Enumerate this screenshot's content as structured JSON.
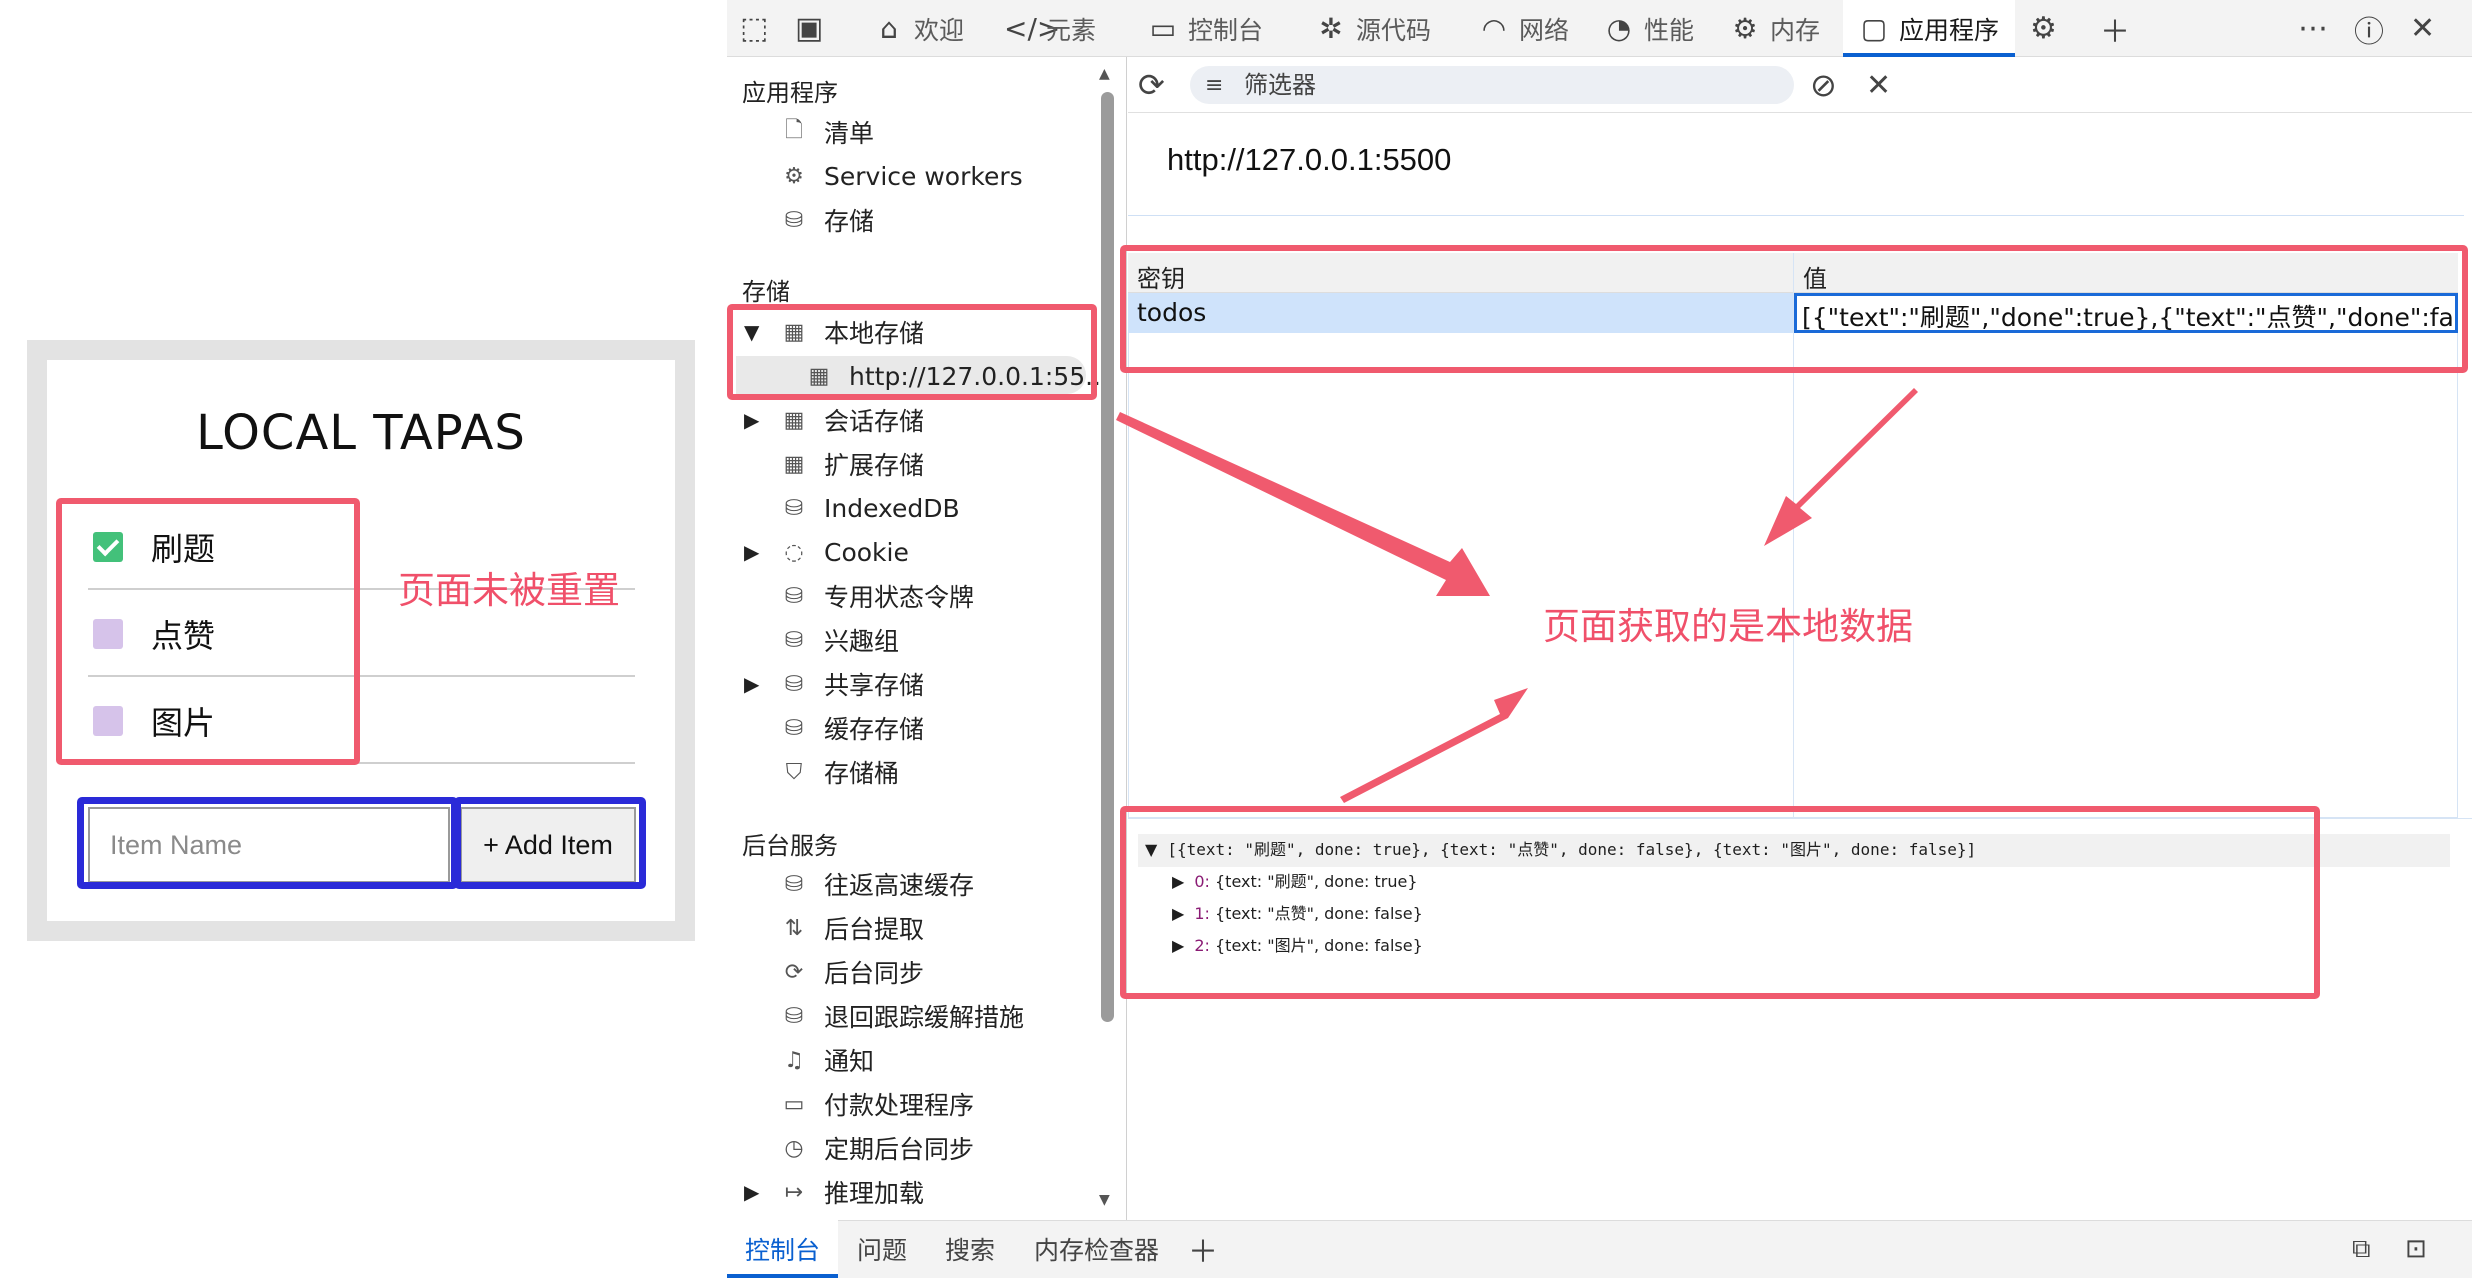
{
  "demo": {
    "title": "LOCAL TAPAS",
    "todos": [
      {
        "text": "刷题",
        "done": true
      },
      {
        "text": "点赞",
        "done": false
      },
      {
        "text": "图片",
        "done": false
      }
    ],
    "input_placeholder": "Item Name",
    "add_button": "+ Add Item",
    "annotation_not_reset": "页面未被重置"
  },
  "devtools": {
    "tabs": [
      {
        "label": "欢迎",
        "icon": "home-icon"
      },
      {
        "label": "元素",
        "icon": "code-icon"
      },
      {
        "label": "控制台",
        "icon": "console-icon"
      },
      {
        "label": "源代码",
        "icon": "bug-icon"
      },
      {
        "label": "网络",
        "icon": "wifi-icon"
      },
      {
        "label": "性能",
        "icon": "gauge-icon"
      },
      {
        "label": "内存",
        "icon": "chip-icon"
      },
      {
        "label": "应用程序",
        "icon": "window-icon",
        "active": true
      }
    ],
    "sidebar": {
      "app_section": "应用程序",
      "app_items": [
        "清单",
        "Service workers",
        "存储"
      ],
      "storage_section": "存储",
      "storage_items": [
        "本地存储",
        "http://127.0.0.1:55...",
        "会话存储",
        "扩展存储",
        "IndexedDB",
        "Cookie",
        "专用状态令牌",
        "兴趣组",
        "共享存储",
        "缓存存储",
        "存储桶"
      ],
      "bg_section": "后台服务",
      "bg_items": [
        "往返高速缓存",
        "后台提取",
        "后台同步",
        "退回跟踪缓解措施",
        "通知",
        "付款处理程序",
        "定期后台同步",
        "推理加载"
      ]
    },
    "filter_placeholder": "筛选器",
    "origin": "http://127.0.0.1:5500",
    "grid": {
      "col_key": "密钥",
      "col_value": "值",
      "row_key": "todos",
      "row_value": "[{\"text\":\"刷题\",\"done\":true},{\"text\":\"点赞\",\"done\":false},{\"..."
    },
    "preview": {
      "root": "[{text: \"刷题\", done: true}, {text: \"点赞\", done: false}, {text: \"图片\", done: false}]",
      "items": [
        {
          "idx": "0",
          "text": "{text: \"刷题\", done: true}"
        },
        {
          "idx": "1",
          "text": "{text: \"点赞\", done: false}"
        },
        {
          "idx": "2",
          "text": "{text: \"图片\", done: false}"
        }
      ]
    },
    "annotation_local": "页面获取的是本地数据",
    "drawer_tabs": [
      "控制台",
      "问题",
      "搜索",
      "内存检查器"
    ]
  },
  "colors": {
    "annotation_red": "#f05a6e",
    "annotation_blue": "#2a2ad8",
    "accent": "#0a60d0"
  }
}
